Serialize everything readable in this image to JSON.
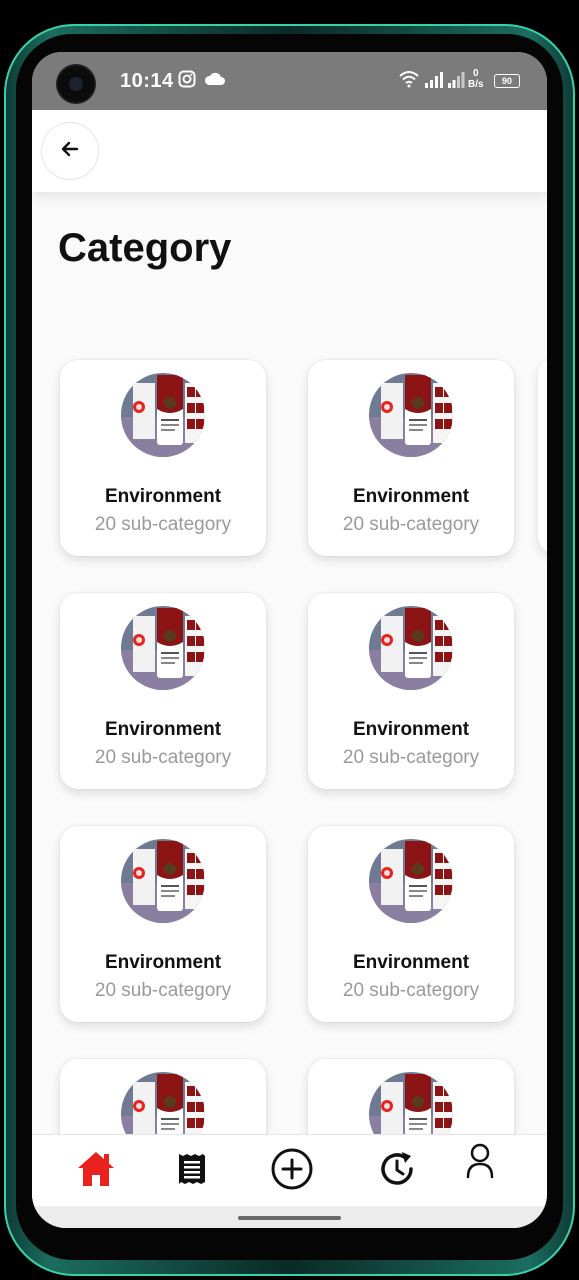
{
  "status_bar": {
    "time": "10:14",
    "net_speed_value": "0",
    "net_speed_unit": "B/s",
    "battery": "90"
  },
  "header": {
    "back_icon": "arrow-left-icon"
  },
  "page": {
    "title": "Category"
  },
  "categories": [
    {
      "title": "Environment",
      "subtitle": "20 sub-category"
    },
    {
      "title": "Environment",
      "subtitle": "20 sub-category"
    },
    {
      "title": "Environment",
      "subtitle": "20 sub-category"
    },
    {
      "title": "Environment",
      "subtitle": "20 sub-category"
    },
    {
      "title": "Environment",
      "subtitle": "20 sub-category"
    },
    {
      "title": "Environment",
      "subtitle": "20 sub-category"
    },
    {
      "title": "",
      "subtitle": ""
    },
    {
      "title": "",
      "subtitle": ""
    }
  ],
  "bottom_nav": {
    "items": [
      {
        "icon": "home-icon",
        "active": true
      },
      {
        "icon": "receipt-icon",
        "active": false
      },
      {
        "icon": "add-circle-icon",
        "active": false
      },
      {
        "icon": "history-icon",
        "active": false
      },
      {
        "icon": "user-icon",
        "active": false
      }
    ]
  },
  "colors": {
    "accent": "#e8231f",
    "status_bar": "#7b7b7b",
    "thumb_red": "#8d1414",
    "thumb_bg": "#6f7a93"
  }
}
